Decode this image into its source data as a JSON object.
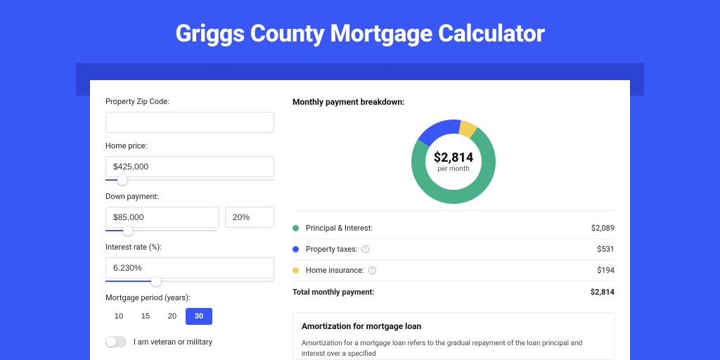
{
  "title": "Griggs County Mortgage Calculator",
  "colors": {
    "accent": "#3857f4",
    "principal": "#49b08a",
    "taxes": "#3857f4",
    "insurance": "#f3cf5a"
  },
  "form": {
    "zip_label": "Property Zip Code:",
    "zip_value": "",
    "home_price_label": "Home price:",
    "home_price_value": "$425,000",
    "home_price_slider_pct": 10,
    "down_payment_label": "Down payment:",
    "down_payment_value": "$85,000",
    "down_payment_pct_value": "20%",
    "down_payment_slider_pct": 20,
    "rate_label": "Interest rate (%):",
    "rate_value": "6.230%",
    "rate_slider_pct": 30,
    "period_label": "Mortgage period (years):",
    "periods": [
      "10",
      "15",
      "20",
      "30"
    ],
    "period_selected": "30",
    "veteran_label": "I am veteran or military",
    "veteran_on": false
  },
  "breakdown": {
    "title": "Monthly payment breakdown:",
    "center_amount": "$2,814",
    "center_sub": "per month",
    "lines": [
      {
        "label": "Principal & Interest:",
        "value": "$2,089",
        "color": "principal",
        "info": false
      },
      {
        "label": "Property taxes:",
        "value": "$531",
        "color": "taxes",
        "info": true
      },
      {
        "label": "Home insurance:",
        "value": "$194",
        "color": "insurance",
        "info": true
      }
    ],
    "total_label": "Total monthly payment:",
    "total_value": "$2,814"
  },
  "amort": {
    "title": "Amortization for mortgage loan",
    "text": "Amortization for a mortgage loan refers to the gradual repayment of the loan principal and interest over a specified"
  },
  "chart_data": {
    "type": "pie",
    "title": "Monthly payment breakdown",
    "series": [
      {
        "name": "Principal & Interest",
        "value": 2089,
        "color": "#49b08a"
      },
      {
        "name": "Property taxes",
        "value": 531,
        "color": "#3857f4"
      },
      {
        "name": "Home insurance",
        "value": 194,
        "color": "#f3cf5a"
      }
    ],
    "total": 2814,
    "center_label": "$2,814 per month"
  }
}
